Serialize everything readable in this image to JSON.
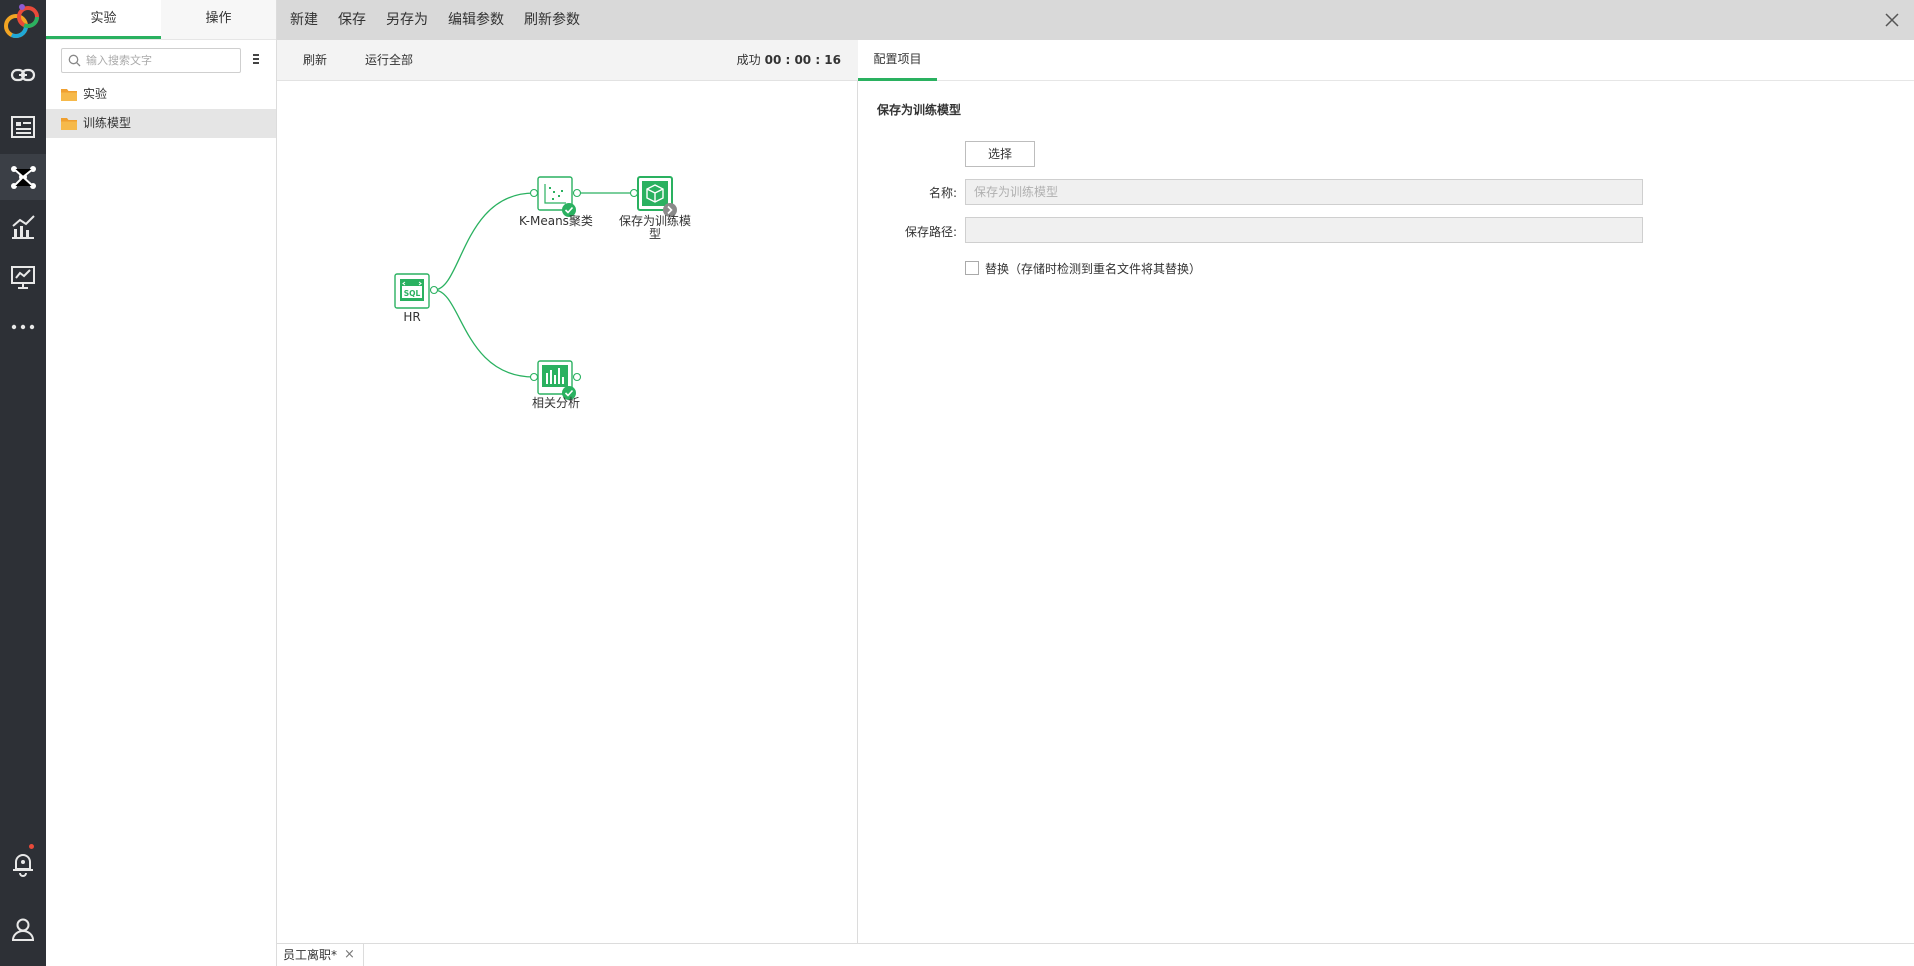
{
  "colors": {
    "rail_bg": "#2d3036",
    "accent": "#2ab160",
    "folder": "#f0a030",
    "notify": "#e84a3a"
  },
  "rail": {
    "items": [
      {
        "name": "link-icon"
      },
      {
        "name": "dataset-icon"
      },
      {
        "name": "network-icon",
        "active": true
      },
      {
        "name": "chart-icon"
      },
      {
        "name": "presentation-icon"
      },
      {
        "name": "more-icon"
      },
      {
        "name": "bell-icon",
        "has_badge": true
      },
      {
        "name": "user-icon"
      }
    ]
  },
  "tree": {
    "tabs": [
      "实验",
      "操作"
    ],
    "active_tab": "实验",
    "search_placeholder": "输入搜索文字",
    "nodes": [
      {
        "label": "实验",
        "icon": "folder-icon",
        "selected": false
      },
      {
        "label": "训练模型",
        "icon": "folder-icon",
        "selected": true
      }
    ]
  },
  "menubar": {
    "items": [
      "新建",
      "保存",
      "另存为",
      "编辑参数",
      "刷新参数"
    ]
  },
  "canvas": {
    "toolbar": {
      "refresh": "刷新",
      "run_all": "运行全部"
    },
    "status": {
      "label": "成功",
      "time": "00 : 00 : 16"
    },
    "flow_nodes": [
      {
        "id": "hr",
        "label": "HR",
        "icon": "sql-icon",
        "state": "none"
      },
      {
        "id": "kmeans",
        "label": "K-Means聚类",
        "icon": "scatter-icon",
        "state": "success"
      },
      {
        "id": "save",
        "label_lines": [
          "保存为训练模",
          "型"
        ],
        "icon": "cube-icon",
        "state": "pending"
      },
      {
        "id": "corr",
        "label": "相关分析",
        "icon": "bar-chart-icon",
        "state": "success"
      }
    ],
    "edges": [
      [
        "hr",
        "kmeans"
      ],
      [
        "hr",
        "corr"
      ],
      [
        "kmeans",
        "save"
      ]
    ]
  },
  "config": {
    "tab": "配置项目",
    "section_title": "保存为训练模型",
    "select_button": "选择",
    "name_label": "名称:",
    "name_placeholder": "保存为训练模型",
    "name_value": "",
    "path_label": "保存路径:",
    "path_value": "",
    "replace_label": "替换（存储时检测到重名文件将其替换）",
    "replace_checked": false
  },
  "bottom": {
    "doc_tab": "员工离职*",
    "close_glyph": "×"
  }
}
